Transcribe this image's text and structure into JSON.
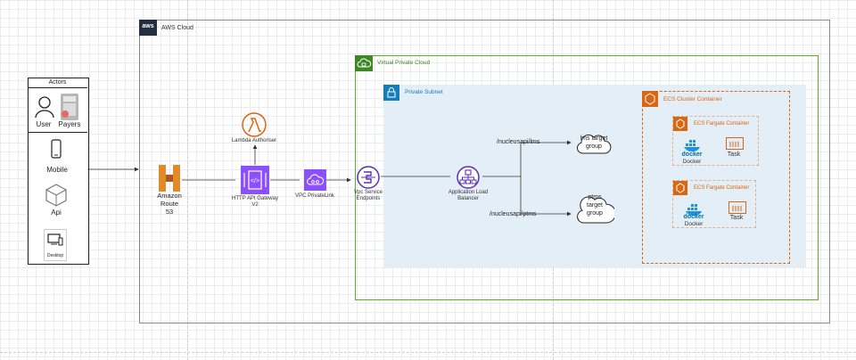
{
  "aws_cloud": {
    "logo": "aws",
    "title": "AWS Cloud"
  },
  "vpc": {
    "title": "Virtual Private Cloud"
  },
  "subnet": {
    "title": "Private Subnet"
  },
  "ecs_cluster": {
    "title": "ECS Cluster Container"
  },
  "fargate": [
    {
      "title": "ECS Fargate Container",
      "docker_label": "Docker",
      "docker_wordmark": "docker",
      "task_label": "Task"
    },
    {
      "title": "ECS Fargate Container",
      "docker_label": "Docker",
      "docker_wordmark": "docker",
      "task_label": "Task"
    }
  ],
  "actors": {
    "title": "Actors",
    "user": "User",
    "payers": "Payers",
    "mobile": "Mobile",
    "api": "Api",
    "desktop": "Desktop"
  },
  "route53": {
    "line1": "Amazon",
    "line2": "Route",
    "line3": "53"
  },
  "lambda": {
    "label": "Lambda Authoriser"
  },
  "api_gateway": {
    "line1": "HTTP API Gateway",
    "line2": "V2"
  },
  "privatelink": {
    "label": "VPC PrivateLink"
  },
  "endpoints": {
    "line1": "Vpc Service",
    "line2": "Endpoints"
  },
  "alb": {
    "line1": "Application Load",
    "line2": "Balancer"
  },
  "routes": {
    "lms": "/nucleusapi/lms",
    "ptms": "/nucleusapi/ptms"
  },
  "target_groups": {
    "lms": {
      "line1": "lms target",
      "line2": "group"
    },
    "ptms": {
      "line1": "ptms",
      "line2": "target",
      "line3": "group"
    }
  },
  "colors": {
    "aws_dark": "#232f3e",
    "vpc_green": "#3f8624",
    "subnet_blue": "#147eba",
    "ecs_orange": "#d86613",
    "compute_purple": "#8c4fff",
    "docker_blue": "#1d91e6"
  }
}
